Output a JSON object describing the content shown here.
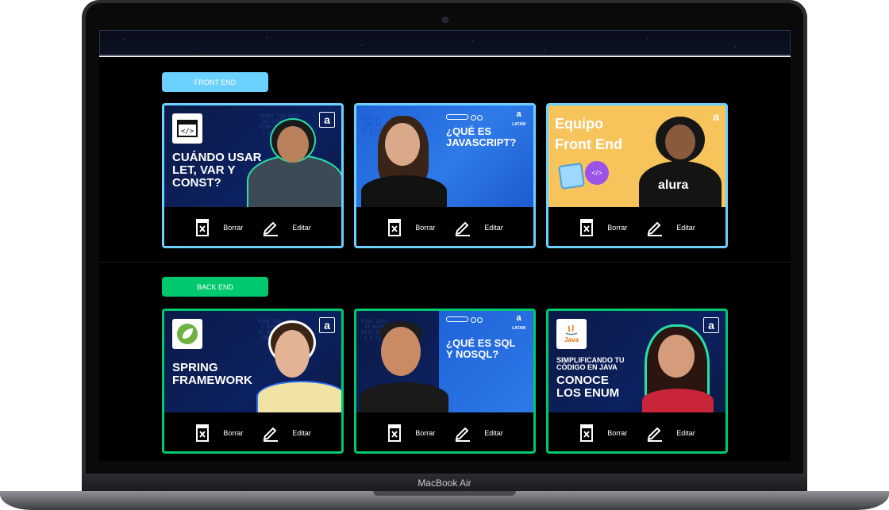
{
  "device": {
    "brand_label": "MacBook Air"
  },
  "sections": [
    {
      "category": "FRONT END",
      "color": "#6bd1ff",
      "videos": [
        {
          "title": "CUÁNDO USAR\nLET, VAR Y\nCONST?",
          "delete_label": "Borrar",
          "edit_label": "Editar"
        },
        {
          "title": "¿QUÉ ES\nJAVASCRIPT?",
          "corner_text": "LATAM",
          "delete_label": "Borrar",
          "edit_label": "Editar"
        },
        {
          "title": "Equipo\nFront End",
          "shirt_text": "alura",
          "delete_label": "Borrar",
          "edit_label": "Editar"
        }
      ]
    },
    {
      "category": "BACK END",
      "color": "#00c86f",
      "videos": [
        {
          "title": "SPRING\nFRAMEWORK",
          "delete_label": "Borrar",
          "edit_label": "Editar"
        },
        {
          "title": "¿QUÉ ES SQL\nY NOSQL?",
          "corner_text": "LATAM",
          "delete_label": "Borrar",
          "edit_label": "Editar"
        },
        {
          "title": "SIMPLIFICANDO TU\nCÓDIGO EN JAVA",
          "title2": "CONOCE\nLOS ENUM",
          "badge_text": "Java",
          "delete_label": "Borrar",
          "edit_label": "Editar"
        }
      ]
    }
  ]
}
